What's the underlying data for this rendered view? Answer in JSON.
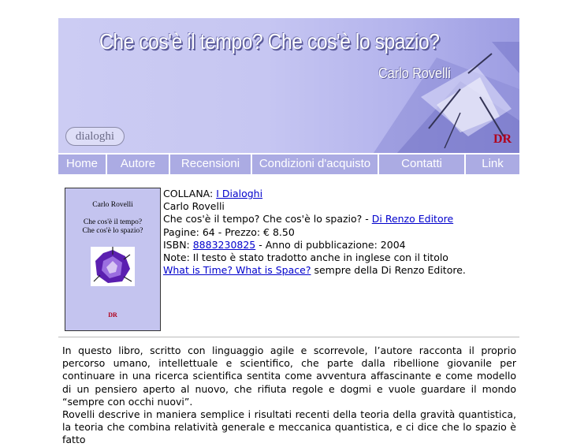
{
  "banner": {
    "title": "Che cos'è il tempo? Che cos'è lo spazio?",
    "author": "Carlo Rovelli",
    "series_logo": "dialoghi",
    "publisher_logo": "DR",
    "colors": {
      "background": "#c6c6f2",
      "text_shadow": "#5a5a9a",
      "logo_red": "#b0001a"
    }
  },
  "nav": {
    "items": [
      {
        "label": "Home"
      },
      {
        "label": "Autore"
      },
      {
        "label": "Recensioni"
      },
      {
        "label": "Condizioni d'acquisto"
      },
      {
        "label": "Contatti"
      },
      {
        "label": "Link"
      }
    ],
    "background": "#ababe3"
  },
  "cover": {
    "author": "Carlo Rovelli",
    "title_line1": "Che cos'è il tempo?",
    "title_line2": "Che cos'è lo spazio?",
    "publisher": "DR",
    "background": "#c4c4ef"
  },
  "info": {
    "collana_label": "COLLANA: ",
    "collana_link": "I Dialoghi",
    "author": "Carlo Rovelli",
    "title_prefix": "Che cos'è il tempo? Che cos'è lo spazio? - ",
    "publisher_link": "Di Renzo Editore",
    "pages_price": "Pagine: 64 - Prezzo: € 8.50",
    "isbn_label": "ISBN: ",
    "isbn_link": "8883230825",
    "year_text": " - Anno di pubblicazione: 2004",
    "note": "Note: Il testo è stato tradotto anche in inglese con il titolo",
    "english_link": "What is Time? What is Space?",
    "english_suffix": " sempre della Di Renzo Editore.",
    "link_color": "#0000cc"
  },
  "description": {
    "paragraph1": "In questo libro, scritto con linguaggio agile e scorrevole, l’autore racconta il proprio percorso umano, intellettuale e scientifico, che parte dalla ribellione giovanile per continuare in una ricerca scientifica sentita come avventura affascinante e come modello di un pensiero aperto al nuovo, che rifiuta regole e dogmi e vuole guardare il mondo “sempre con occhi nuovi”.",
    "paragraph2": "Rovelli descrive in maniera semplice i risultati recenti della teoria della gravità quantistica, la teoria che combina relatività generale e meccanica quantistica, e ci dice che lo spazio è fatto"
  }
}
